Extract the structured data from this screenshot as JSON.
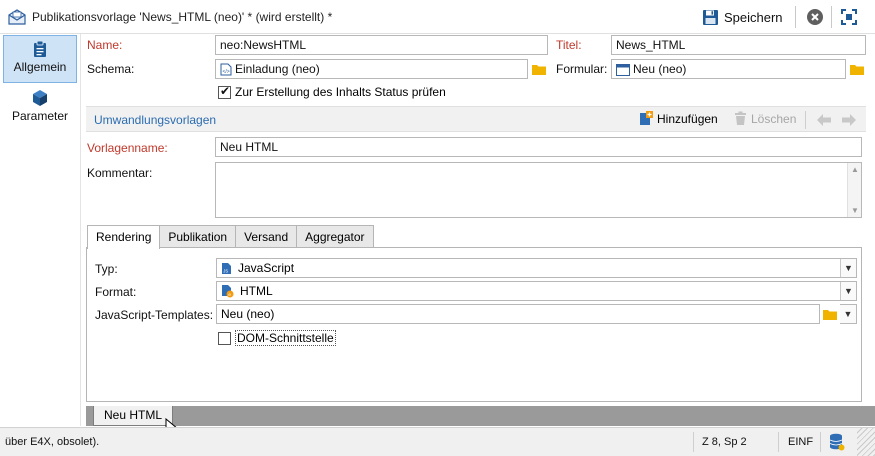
{
  "window": {
    "title": "Publikationsvorlage 'News_HTML (neo)' * (wird erstellt) *",
    "save_label": "Speichern"
  },
  "nav": {
    "items": [
      {
        "label": "Allgemein",
        "icon": "clipboard-icon",
        "active": true
      },
      {
        "label": "Parameter",
        "icon": "cube-icon",
        "active": false
      }
    ]
  },
  "form": {
    "name_label": "Name:",
    "name_value": "neo:NewsHTML",
    "titel_label": "Titel:",
    "titel_value": "News_HTML",
    "schema_label": "Schema:",
    "schema_value": "Einladung (neo)",
    "formular_label": "Formular:",
    "formular_value": "Neu (neo)",
    "status_check_label": "Zur Erstellung des Inhalts Status prüfen",
    "status_checked": true
  },
  "section": {
    "title": "Umwandlungsvorlagen",
    "add_label": "Hinzufügen",
    "delete_label": "Löschen"
  },
  "template": {
    "vorlagenname_label": "Vorlagenname:",
    "vorlagenname_value": "Neu HTML",
    "kommentar_label": "Kommentar:",
    "kommentar_value": ""
  },
  "tabs": [
    {
      "label": "Rendering",
      "active": true
    },
    {
      "label": "Publikation",
      "active": false
    },
    {
      "label": "Versand",
      "active": false
    },
    {
      "label": "Aggregator",
      "active": false
    }
  ],
  "rendering": {
    "typ_label": "Typ:",
    "typ_value": "JavaScript",
    "format_label": "Format:",
    "format_value": "HTML",
    "js_templates_label": "JavaScript-Templates:",
    "js_templates_value": "Neu (neo)",
    "dom_label": "DOM-Schnittstelle",
    "dom_checked": false
  },
  "bottom_tab": {
    "label": "Neu HTML"
  },
  "status": {
    "message": "über E4X, obsolet).",
    "position": "Z 8, Sp 2",
    "mode": "EINF"
  },
  "colors": {
    "accent": "#2b6cb0",
    "required_label": "#c0392b",
    "active_nav": "#cfe3f7",
    "folder": "#f0b400"
  }
}
